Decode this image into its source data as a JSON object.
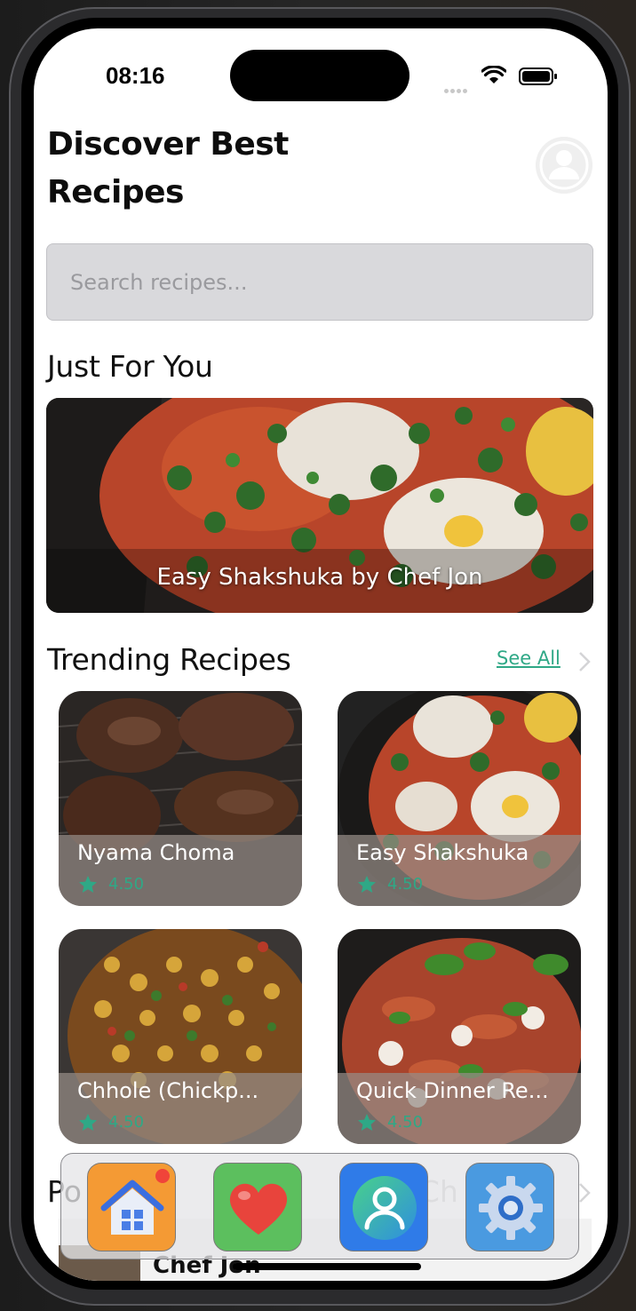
{
  "status_bar": {
    "time": "08:16"
  },
  "header": {
    "title": "Discover Best Recipes"
  },
  "search": {
    "placeholder": "Search recipes..."
  },
  "just_for_you": {
    "title": "Just For You",
    "featured_caption": "Easy Shakshuka by Chef Jon"
  },
  "trending": {
    "title": "Trending Recipes",
    "see_all": "See All",
    "cards": [
      {
        "title": "Nyama Choma",
        "rating": "4.50"
      },
      {
        "title": "Easy Shakshuka",
        "rating": "4.50"
      },
      {
        "title": "Chhole (Chickp...",
        "rating": "4.50"
      },
      {
        "title": "Quick Dinner Re...",
        "rating": "4.50"
      }
    ]
  },
  "popular": {
    "title_visible": "Po",
    "title_visible_2": "Ch",
    "chef_name": "Chef Jon"
  },
  "tab_bar": {
    "items": [
      {
        "icon": "home-icon",
        "color": "#f49a34"
      },
      {
        "icon": "heart-icon",
        "color": "#5cbf5e"
      },
      {
        "icon": "profile-icon",
        "color": "#2f7be8"
      },
      {
        "icon": "settings-icon",
        "color": "#4a9ae0"
      }
    ]
  },
  "colors": {
    "accent": "#2fa886"
  }
}
